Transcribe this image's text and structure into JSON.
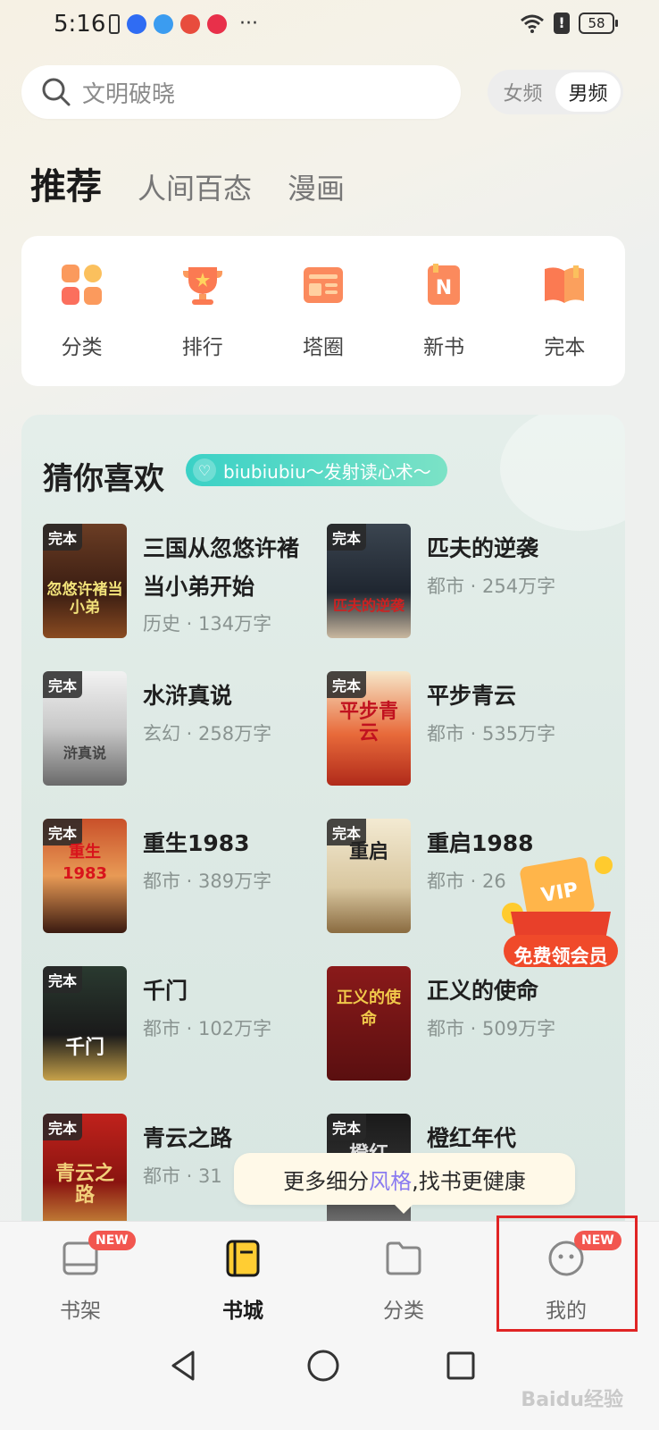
{
  "status_bar": {
    "time": "5:16",
    "battery": "58",
    "more": "···",
    "warn": "!"
  },
  "search": {
    "placeholder": "文明破晓"
  },
  "gender": {
    "female": "女频",
    "male": "男频"
  },
  "tabs": [
    "推荐",
    "人间百态",
    "漫画"
  ],
  "quick_nav": [
    {
      "label": "分类",
      "icon": "category-grid-icon"
    },
    {
      "label": "排行",
      "icon": "trophy-icon"
    },
    {
      "label": "塔圈",
      "icon": "newspaper-icon"
    },
    {
      "label": "新书",
      "icon": "new-book-icon"
    },
    {
      "label": "完本",
      "icon": "open-book-icon"
    }
  ],
  "guess": {
    "title": "猜你喜欢",
    "badge": "biubiubiu～发射读心术～",
    "books": [
      {
        "title": "三国从忽悠许褚当小弟开始",
        "meta": "历史 · 134万字",
        "tag": "完本",
        "cover_text": "忽悠许褚当小弟"
      },
      {
        "title": "匹夫的逆袭",
        "meta": "都市 · 254万字",
        "tag": "完本",
        "cover_text": "匹夫的逆袭"
      },
      {
        "title": "水浒真说",
        "meta": "玄幻 · 258万字",
        "tag": "完本",
        "cover_text": "浒真说"
      },
      {
        "title": "平步青云",
        "meta": "都市 · 535万字",
        "tag": "完本",
        "cover_text": "平步青云"
      },
      {
        "title": "重生1983",
        "meta": "都市 · 389万字",
        "tag": "完本",
        "cover_text": "重生1983"
      },
      {
        "title": "重启1988",
        "meta": "都市 · 26",
        "tag": "完本",
        "cover_text": "重启"
      },
      {
        "title": "千门",
        "meta": "都市 · 102万字",
        "tag": "完本",
        "cover_text": "千门"
      },
      {
        "title": "正义的使命",
        "meta": "都市 · 509万字",
        "tag": "",
        "cover_text": "正义的使命"
      },
      {
        "title": "青云之路",
        "meta": "都市 · 31",
        "tag": "完本",
        "cover_text": "青云之路"
      },
      {
        "title": "橙红年代",
        "meta": "",
        "tag": "完本",
        "cover_text": "橙红"
      }
    ]
  },
  "vip": {
    "label": "免费领会员",
    "tag": "VIP"
  },
  "tooltip": {
    "prefix": "更多细分",
    "highlight": "风格",
    "suffix": ",找书更健康"
  },
  "bottom_nav": [
    {
      "label": "书架",
      "icon": "bookshelf-icon",
      "badge": "NEW"
    },
    {
      "label": "书城",
      "icon": "bookstore-icon",
      "badge": ""
    },
    {
      "label": "分类",
      "icon": "folder-icon",
      "badge": ""
    },
    {
      "label": "我的",
      "icon": "profile-face-icon",
      "badge": "NEW"
    }
  ],
  "watermark": "Baidu经验",
  "colors": {
    "accent_teal": "#3ad1c6",
    "badge_red": "#f2564f",
    "highlight_red": "#e02424",
    "tooltip_purple": "#8a7bf0"
  }
}
